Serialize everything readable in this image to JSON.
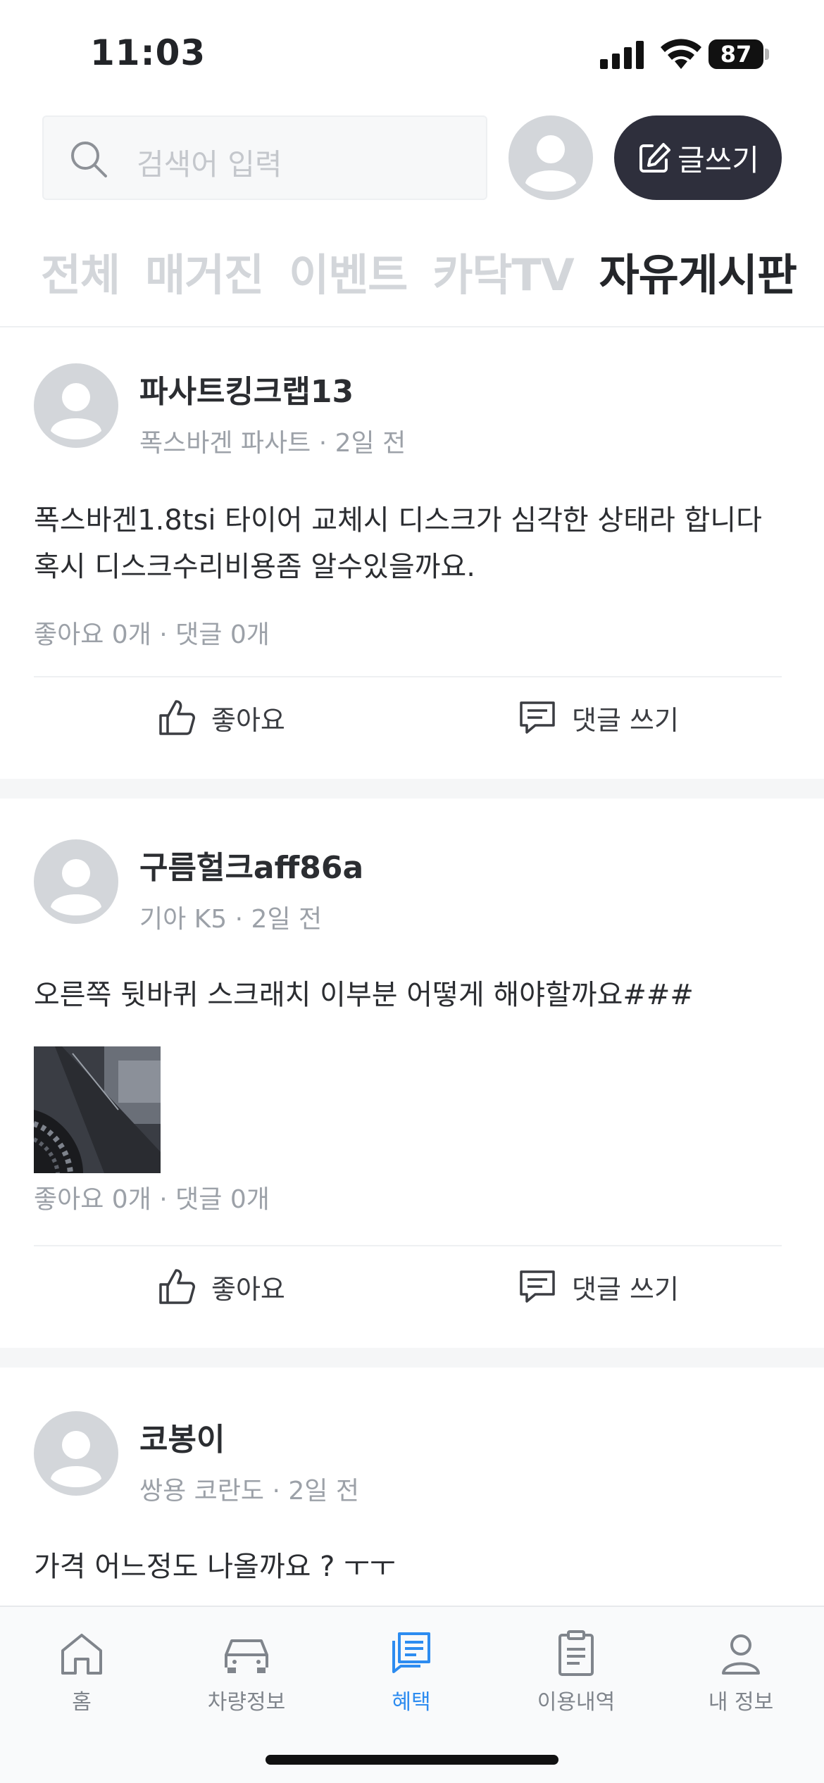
{
  "status_bar": {
    "time": "11:03",
    "battery": "87"
  },
  "header": {
    "search_placeholder": "검색어 입력",
    "write_button_label": "글쓰기",
    "icons": {
      "search": "search-icon",
      "profile": "user-avatar-icon",
      "write": "edit-icon"
    }
  },
  "tabs": [
    {
      "label": "전체",
      "active": false
    },
    {
      "label": "매거진",
      "active": false
    },
    {
      "label": "이벤트",
      "active": false
    },
    {
      "label": "카닥TV",
      "active": false
    },
    {
      "label": "자유게시판",
      "active": true
    }
  ],
  "posts": [
    {
      "author": "파사트킹크랩13",
      "car": "폭스바겐 파사트",
      "time": "2일 전",
      "body": "폭스바겐1.8tsi 타이어 교체시 디스크가 심각한 상태라 합니다 혹시 디스크수리비용좀 알수있을까요.",
      "likes": "좋아요 0개",
      "comments": "댓글 0개",
      "like_label": "좋아요",
      "comment_label": "댓글 쓰기",
      "has_photo": false
    },
    {
      "author": "구름헐크aff86a",
      "car": "기아 K5",
      "time": "2일 전",
      "body": "오른쪽 뒷바퀴 스크래치 이부분 어떻게 해야할까요###",
      "likes": "좋아요 0개",
      "comments": "댓글 0개",
      "like_label": "좋아요",
      "comment_label": "댓글 쓰기",
      "has_photo": true
    },
    {
      "author": "코봉이",
      "car": "쌍용 코란도",
      "time": "2일 전",
      "body": "가격 어느정도 나올까요 ? ㅜㅜ"
    }
  ],
  "bottom_nav": [
    {
      "label": "홈",
      "icon": "home-icon",
      "active": false
    },
    {
      "label": "차량정보",
      "icon": "car-icon",
      "active": false
    },
    {
      "label": "혜택",
      "icon": "document-chat-icon",
      "active": true
    },
    {
      "label": "이용내역",
      "icon": "clipboard-icon",
      "active": false
    },
    {
      "label": "내 정보",
      "icon": "person-icon",
      "active": false
    }
  ],
  "colors": {
    "accent": "#2d8cf0",
    "dark_button": "#2e2f3c",
    "muted_text": "#9ca1a8"
  }
}
